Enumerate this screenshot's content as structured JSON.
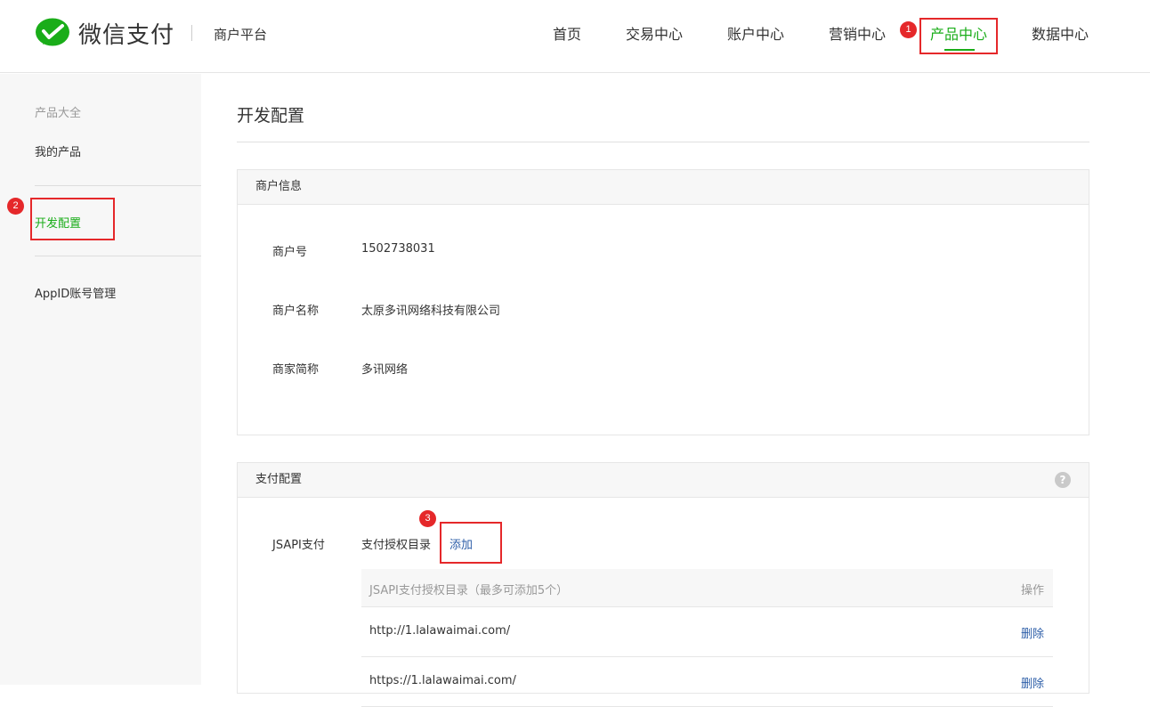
{
  "header": {
    "brand": "微信支付",
    "platform": "商户平台",
    "nav": [
      {
        "label": "首页"
      },
      {
        "label": "交易中心"
      },
      {
        "label": "账户中心"
      },
      {
        "label": "营销中心"
      },
      {
        "label": "产品中心",
        "active": true
      },
      {
        "label": "数据中心"
      }
    ]
  },
  "annotations": [
    "1",
    "2",
    "3"
  ],
  "sidebar": {
    "title": "产品大全",
    "items": [
      {
        "label": "我的产品"
      },
      {
        "label": "开发配置",
        "active": true
      },
      {
        "label": "AppID账号管理"
      }
    ]
  },
  "main": {
    "title": "开发配置",
    "merchant_info": {
      "heading": "商户信息",
      "fields": [
        {
          "label": "商户号",
          "value": "1502738031"
        },
        {
          "label": "商户名称",
          "value": "太原多讯网络科技有限公司"
        },
        {
          "label": "商家简称",
          "value": "多讯网络"
        }
      ]
    },
    "pay_config": {
      "heading": "支付配置",
      "help_icon": "?",
      "jsapi_label": "JSAPI支付",
      "auth_dir_label": "支付授权目录",
      "add_label": "添加",
      "table": {
        "col_dir": "JSAPI支付授权目录（最多可添加5个）",
        "col_action": "操作",
        "rows": [
          {
            "url": "http://1.lalawaimai.com/",
            "action": "删除"
          },
          {
            "url": "https://1.lalawaimai.com/",
            "action": "删除"
          }
        ]
      }
    }
  },
  "colors": {
    "accent": "#1aad19",
    "annotation": "#e5282a",
    "link": "#2d5ea8"
  }
}
